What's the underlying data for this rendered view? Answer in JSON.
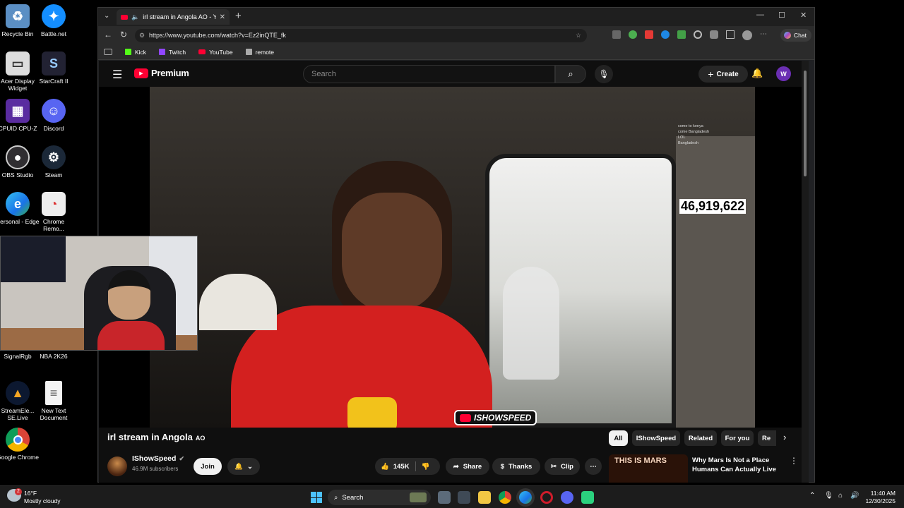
{
  "desktop": {
    "icons": [
      {
        "label": "Recycle Bin",
        "icon": "recycle-bin-icon"
      },
      {
        "label": "Battle.net",
        "icon": "battlenet-icon"
      },
      {
        "label": "Acer Display Widget",
        "icon": "acer-display-icon"
      },
      {
        "label": "StarCraft II",
        "icon": "starcraft-icon"
      },
      {
        "label": "CPUID CPU-Z",
        "icon": "cpuz-icon"
      },
      {
        "label": "Discord",
        "icon": "discord-icon"
      },
      {
        "label": "OBS Studio",
        "icon": "obs-icon"
      },
      {
        "label": "Steam",
        "icon": "steam-icon"
      },
      {
        "label": "Personal - Edge",
        "icon": "edge-icon"
      },
      {
        "label": "Chrome Remo...",
        "icon": "chrome-remote-icon"
      },
      {
        "label": "SignalRgb",
        "icon": "signalrgb-icon"
      },
      {
        "label": "NBA 2K26",
        "icon": "nba2k-icon"
      },
      {
        "label": "StreamEle... SE.Live",
        "icon": "streamelements-icon"
      },
      {
        "label": "New Text Document",
        "icon": "text-document-icon"
      },
      {
        "label": "Google Chrome",
        "icon": "chrome-icon"
      }
    ]
  },
  "browser": {
    "tab_title": "irl stream in Angola AO - YouTube",
    "url": "https://www.youtube.com/watch?v=Ez2inQTE_fk",
    "chat_label": "Chat",
    "bookmarks": [
      {
        "label": "Kick",
        "color": "#53fc18"
      },
      {
        "label": "Twitch",
        "color": "#9146ff"
      },
      {
        "label": "YouTube",
        "color": "#ff0033"
      },
      {
        "label": "remote",
        "color": "#aaaaaa"
      }
    ]
  },
  "youtube": {
    "logo_text": "Premium",
    "search_placeholder": "Search",
    "create_label": "Create",
    "avatar_letter": "W",
    "video": {
      "counter": "46,919,622",
      "watermark": "ISHOWSPEED",
      "chat_lines": [
        "come to kenya",
        "come Bangladesh",
        "LOL",
        "Bangladesh"
      ]
    },
    "title": "irl stream in Angola",
    "title_flag": "AO",
    "channel": {
      "name": "IShowSpeed",
      "subscribers": "46.9M subscribers",
      "join_label": "Join"
    },
    "actions": {
      "likes": "145K",
      "share": "Share",
      "thanks": "Thanks",
      "clip": "Clip"
    },
    "chips": [
      "All",
      "IShowSpeed",
      "Related",
      "For you",
      "Re"
    ],
    "recommended": {
      "thumb_text": "THIS IS MARS",
      "title": "Why Mars Is Not a Place Humans Can Actually Live"
    }
  },
  "taskbar": {
    "weather_temp": "16°F",
    "weather_desc": "Mostly cloudy",
    "weather_badge": "2",
    "search_label": "Search",
    "time": "11:40 AM",
    "date": "12/30/2025"
  },
  "colors": {
    "yt_red": "#ff0033",
    "accent_purple": "#6b2fb3"
  }
}
